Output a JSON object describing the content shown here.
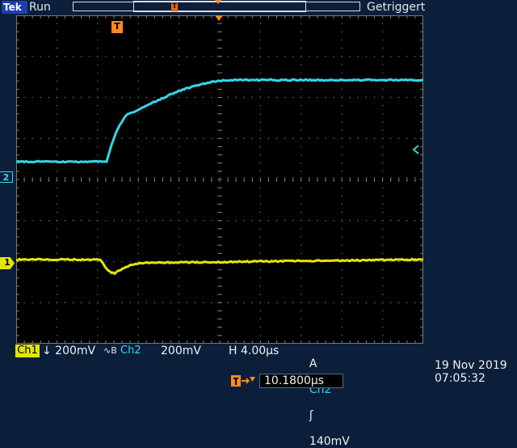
{
  "header": {
    "brand": "Tek",
    "run_state": "Run",
    "trigger_status": "Getriggert",
    "record_marker": "T"
  },
  "screen": {
    "trigger_marker": "T",
    "ch1_marker": "1",
    "ch2_marker": "2"
  },
  "readouts": {
    "ch1_label": "Ch1",
    "ch1_scale": "↓ 200mV",
    "bandwidth_icon": "∿B",
    "ch2_label": "Ch2",
    "ch2_scale": "200mV",
    "horizontal": "H 4.00µs",
    "trigger_mode": "A",
    "trigger_source": "Ch2",
    "trigger_slope": "ʃ",
    "trigger_level": "140mV",
    "trigger_delay": "10.1800µs",
    "date": "19 Nov 2019",
    "time": "07:05:32"
  },
  "colors": {
    "ch1": "#e5e600",
    "ch2": "#33d6e6",
    "accent": "#ff8a1a",
    "background": "#0b1f3a",
    "grid": "#7a7a7a"
  }
}
